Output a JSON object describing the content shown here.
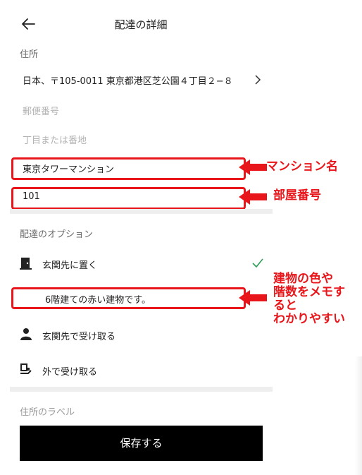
{
  "header": {
    "title": "配達の詳細"
  },
  "address": {
    "section_label": "住所",
    "full_address": "日本、〒105-0011 東京都港区芝公園４丁目２−８",
    "postal_placeholder": "郵便番号",
    "street_placeholder": "丁目または番地",
    "building_value": "東京タワーマンション",
    "room_value": "101"
  },
  "delivery_options": {
    "section_label": "配達のオプション",
    "items": [
      {
        "label": "玄関先に置く",
        "icon": "door-icon",
        "selected": true
      },
      {
        "label": "玄関先で受け取る",
        "icon": "person-icon",
        "selected": false
      },
      {
        "label": "外で受け取る",
        "icon": "handoff-icon",
        "selected": false
      }
    ],
    "note_value": "6階建ての赤い建物です。"
  },
  "address_label": {
    "section_label": "住所のラベル"
  },
  "save_button": {
    "label": "保存する"
  },
  "annotations": {
    "building": "マンション名",
    "room": "部屋番号",
    "note_lines": [
      "建物の色や",
      "階数をメモす",
      "ると",
      "わかりやすい"
    ]
  },
  "colors": {
    "annotation_red": "#e8161a",
    "check_green": "#2e9e58",
    "button_bg": "#000000"
  }
}
